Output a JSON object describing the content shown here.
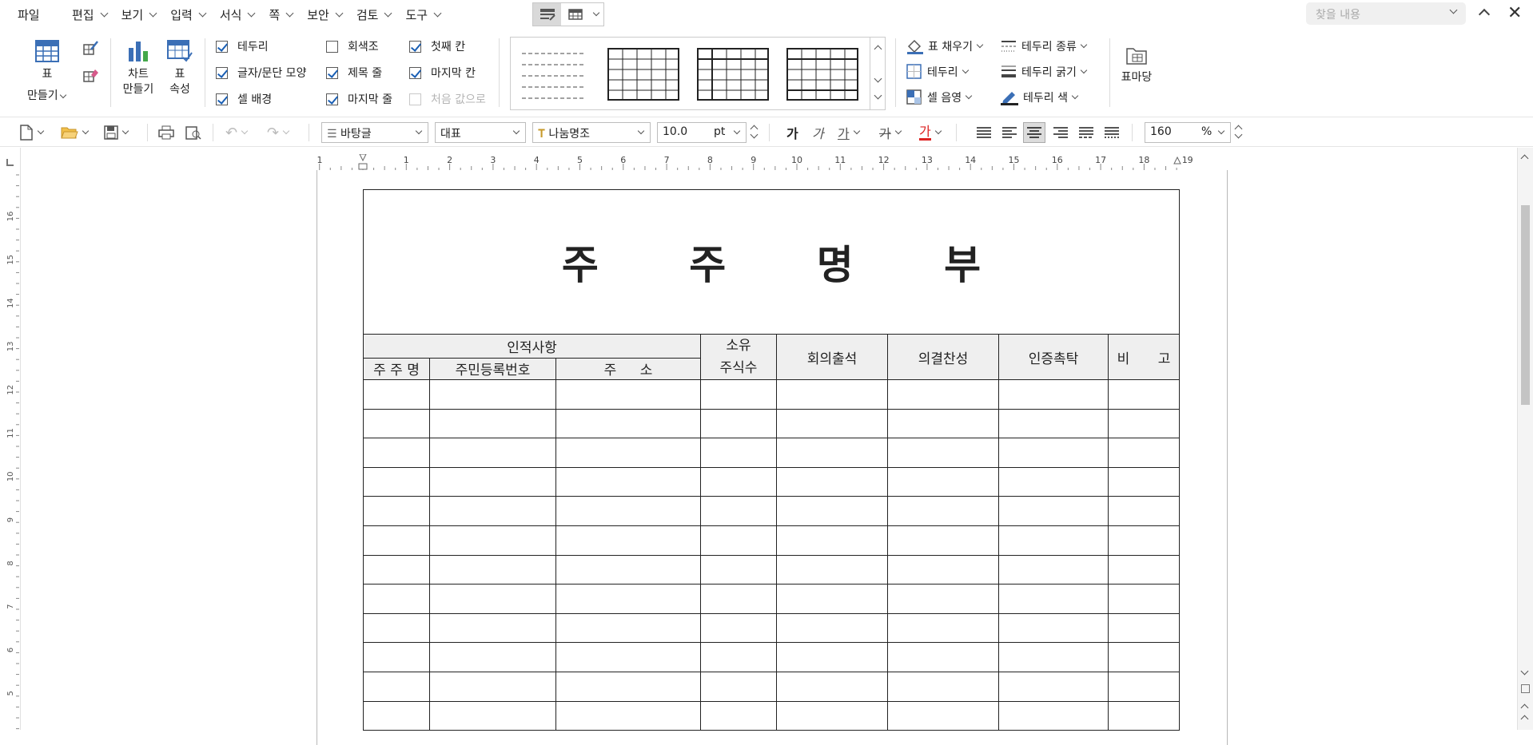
{
  "menubar": {
    "file_label": "파일",
    "menus": [
      "편집",
      "보기",
      "입력",
      "서식",
      "쪽",
      "보안",
      "검토",
      "도구"
    ],
    "search_placeholder": "찾을 내용"
  },
  "ribbon": {
    "make_table_line1": "표",
    "make_table_line2": "만들기",
    "chart_line1": "차트",
    "chart_line2": "만들기",
    "table_props_line1": "표",
    "table_props_line2": "속성",
    "checkboxes": {
      "border": {
        "label": "테두리",
        "checked": true
      },
      "text_para_shape": {
        "label": "글자/문단 모양",
        "checked": true
      },
      "cell_bg": {
        "label": "셀 배경",
        "checked": true
      },
      "grayscale": {
        "label": "회색조",
        "checked": false
      },
      "title_row": {
        "label": "제목 줄",
        "checked": true
      },
      "last_row": {
        "label": "마지막 줄",
        "checked": true
      },
      "first_col": {
        "label": "첫째 칸",
        "checked": true
      },
      "last_col": {
        "label": "마지막 칸",
        "checked": true
      },
      "reset": {
        "label": "처음 값으로",
        "checked": false
      }
    },
    "fill_label": "표 채우기",
    "border_label": "테두리",
    "cell_shade_label": "셀 음영",
    "border_type_label": "테두리 종류",
    "border_width_label": "테두리 굵기",
    "border_color_label": "테두리 색",
    "table_yard_label": "표마당"
  },
  "toolbar": {
    "style": "바탕글",
    "font_group": "대표",
    "font": "나눔명조",
    "size": "10.0",
    "size_unit": "pt",
    "bold_char": "가",
    "italic_char": "가",
    "underline_char": "가",
    "strike_char": "가",
    "color_char": "가",
    "zoom": "160",
    "zoom_unit": "%"
  },
  "ruler": {
    "h_numbers": [
      "1",
      "1",
      "2",
      "3",
      "4",
      "5",
      "6",
      "7",
      "8",
      "9",
      "10",
      "11",
      "12",
      "13",
      "14",
      "15",
      "16",
      "17",
      "18",
      "19"
    ],
    "v_numbers": [
      "16",
      "15",
      "14",
      "13",
      "12",
      "11",
      "10",
      "9",
      "8",
      "7",
      "6",
      "5"
    ]
  },
  "document": {
    "title": "주 주 명 부",
    "header": {
      "personal_info": "인적사항",
      "shareholder_name": "주 주 명",
      "resident_id": "주민등록번호",
      "address": "주 소",
      "owned_line1": "소유",
      "owned_line2": "주식수",
      "meeting_attend": "회의출석",
      "resolution_approve": "의결찬성",
      "proxy": "인증촉탁",
      "remarks": "비 고"
    },
    "empty_rows": 12
  }
}
